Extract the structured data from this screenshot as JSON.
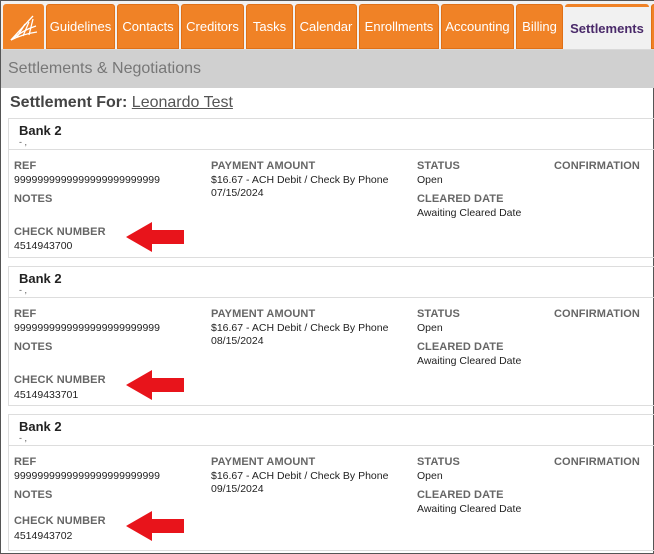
{
  "tabs": [
    {
      "label": "Guidelines"
    },
    {
      "label": "Contacts"
    },
    {
      "label": "Creditors"
    },
    {
      "label": "Tasks"
    },
    {
      "label": "Calendar"
    },
    {
      "label": "Enrollments"
    },
    {
      "label": "Accounting"
    },
    {
      "label": "Billing"
    },
    {
      "label": "Settlements",
      "active": true
    }
  ],
  "section_title": "Settlements & Negotiations",
  "settlement_for_label": "Settlement For:",
  "settlement_for_name": "Leonardo Test",
  "labels": {
    "ref": "REF",
    "payment_amount": "PAYMENT AMOUNT",
    "status": "STATUS",
    "confirmation": "CONFIRMATION",
    "notes": "NOTES",
    "cleared_date": "CLEARED DATE",
    "check_number": "CHECK NUMBER"
  },
  "settlements": [
    {
      "bank": "Bank 2",
      "bank_sub": "- ,",
      "ref": "9999999999999999999999999",
      "payment_line": "$16.67 - ACH Debit / Check By Phone",
      "payment_date": "07/15/2024",
      "status": "Open",
      "cleared_date": "Awaiting Cleared Date",
      "check_number": "4514943700"
    },
    {
      "bank": "Bank 2",
      "bank_sub": "- ,",
      "ref": "9999999999999999999999999",
      "payment_line": "$16.67 - ACH Debit / Check By Phone",
      "payment_date": "08/15/2024",
      "status": "Open",
      "cleared_date": "Awaiting Cleared Date",
      "check_number": "45149433701"
    },
    {
      "bank": "Bank 2",
      "bank_sub": "- ,",
      "ref": "9999999999999999999999999",
      "payment_line": "$16.67 - ACH Debit / Check By Phone",
      "payment_date": "09/15/2024",
      "status": "Open",
      "cleared_date": "Awaiting Cleared Date",
      "check_number": "4514943702"
    }
  ],
  "colors": {
    "tab_orange": "#f08226",
    "arrow_red": "#e8141b",
    "active_tab_text": "#4a2a6a"
  },
  "icons": {
    "logo": "wave-grid-logo-icon",
    "annotation": "red-arrow-icon"
  }
}
